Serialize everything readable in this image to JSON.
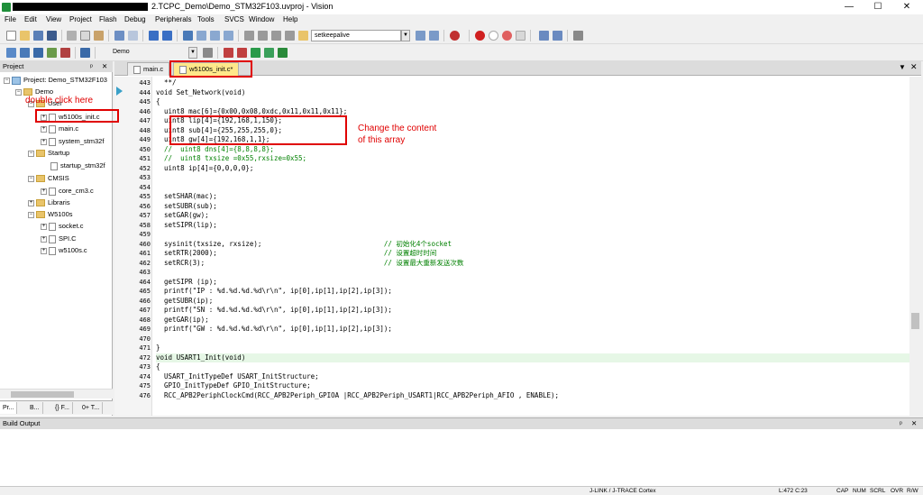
{
  "window": {
    "title_suffix": "2.TCPC_Demo\\Demo_STM32F103.uvproj -  Vision",
    "controls": [
      "—",
      "☐",
      "✕"
    ]
  },
  "menu": [
    "File",
    "Edit",
    "View",
    "Project",
    "Flash",
    "Debug",
    "Peripherals",
    "Tools",
    "SVCS",
    "Window",
    "Help"
  ],
  "toolbar": {
    "find_combo_value": "setkeepalive",
    "target_combo_value": "Demo"
  },
  "project_panel": {
    "header": "Project",
    "pin_glyph": "ᵖ",
    "close_glyph": "✕",
    "root": "Project: Demo_STM32F103",
    "target": "Demo",
    "group_user": "User",
    "files_user": [
      "w5100s_init.c",
      "main.c",
      "system_stm32f"
    ],
    "group_startup": "Startup",
    "files_startup": [
      "startup_stm32f"
    ],
    "group_cmsis": "CMSIS",
    "files_cmsis": [
      "core_cm3.c"
    ],
    "group_libraris": "Libraris",
    "group_w5100s": "W5100s",
    "files_w5100s": [
      "socket.c",
      "SPI.C",
      "w5100s.c"
    ],
    "tabs": [
      "Pr...",
      "B...",
      "{} F...",
      "0+ T..."
    ]
  },
  "editor": {
    "tabs": [
      {
        "label": "main.c",
        "active": false
      },
      {
        "label": "w5100s_init.c*",
        "active": true
      }
    ],
    "lines": [
      {
        "n": "443",
        "text": "  **/"
      },
      {
        "n": "444",
        "text": "void Set_Network(void)"
      },
      {
        "n": "445",
        "text": "{"
      },
      {
        "n": "446",
        "text": "  uint8 mac[6]={0x00,0x08,0xdc,0x11,0x11,0x11};"
      },
      {
        "n": "447",
        "text": "  uint8 lip[4]={192,168,1,150};"
      },
      {
        "n": "448",
        "text": "  uint8 sub[4]={255,255,255,0};"
      },
      {
        "n": "449",
        "text": "  uint8 gw[4]={192,168,1,1};"
      },
      {
        "n": "450",
        "text": "  //  uint8 dns[4]={8,8,8,8};"
      },
      {
        "n": "451",
        "text": "  //  uint8 txsize =0x55,rxsize=0x55;"
      },
      {
        "n": "452",
        "text": "  uint8 ip[4]={0,0,0,0};"
      },
      {
        "n": "453",
        "text": ""
      },
      {
        "n": "454",
        "text": ""
      },
      {
        "n": "455",
        "text": "  setSHAR(mac);"
      },
      {
        "n": "456",
        "text": "  setSUBR(sub);"
      },
      {
        "n": "457",
        "text": "  setGAR(gw);"
      },
      {
        "n": "458",
        "text": "  setSIPR(lip);"
      },
      {
        "n": "459",
        "text": ""
      },
      {
        "n": "460",
        "text": "  sysinit(txsize, rxsize);                              // 初始化4个socket"
      },
      {
        "n": "461",
        "text": "  setRTR(2000);                                         // 设置超时时间"
      },
      {
        "n": "462",
        "text": "  setRCR(3);                                            // 设置最大重新发送次数"
      },
      {
        "n": "463",
        "text": ""
      },
      {
        "n": "464",
        "text": "  getSIPR (ip);"
      },
      {
        "n": "465",
        "text": "  printf(\"IP : %d.%d.%d.%d\\r\\n\", ip[0],ip[1],ip[2],ip[3]);"
      },
      {
        "n": "466",
        "text": "  getSUBR(ip);"
      },
      {
        "n": "467",
        "text": "  printf(\"SN : %d.%d.%d.%d\\r\\n\", ip[0],ip[1],ip[2],ip[3]);"
      },
      {
        "n": "468",
        "text": "  getGAR(ip);"
      },
      {
        "n": "469",
        "text": "  printf(\"GW : %d.%d.%d.%d\\r\\n\", ip[0],ip[1],ip[2],ip[3]);"
      },
      {
        "n": "470",
        "text": ""
      },
      {
        "n": "471",
        "text": "}"
      },
      {
        "n": "472",
        "text": "void USART1_Init(void)"
      },
      {
        "n": "473",
        "text": "{"
      },
      {
        "n": "474",
        "text": "  USART_InitTypeDef USART_InitStructure;"
      },
      {
        "n": "475",
        "text": "  GPIO_InitTypeDef GPIO_InitStructure;"
      },
      {
        "n": "476",
        "text": "  RCC_APB2PeriphClockCmd(RCC_APB2Periph_GPIOA |RCC_APB2Periph_USART1|RCC_APB2Periph_AFIO , ENABLE);"
      }
    ]
  },
  "build_output": {
    "header": "Build Output",
    "pin_glyph": "ᵖ",
    "close_glyph": "✕"
  },
  "statusbar": {
    "debugger": "J-LINK / J-TRACE Cortex",
    "position": "L:472 C:23",
    "indicators": [
      "CAP",
      "NUM",
      "SCRL",
      "OVR",
      "R/W"
    ]
  },
  "annotations": {
    "double_click": "double click here",
    "change_content_1": "Change the content",
    "change_content_2": "of this array"
  },
  "colors": {
    "annotation_red": "#e00000",
    "keyword": "#00008b",
    "comment": "#008000",
    "literal": "#800080",
    "active_tab": "#ffe88a"
  }
}
